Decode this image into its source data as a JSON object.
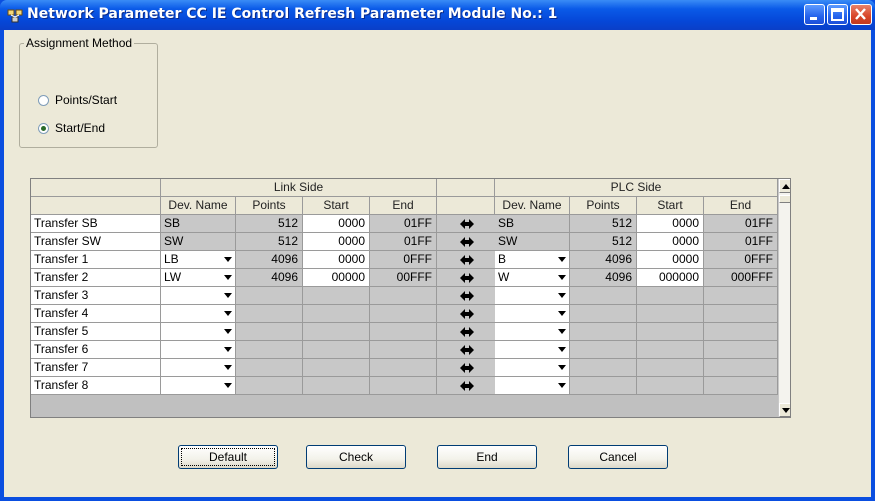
{
  "window": {
    "title": "Network Parameter  CC IE Control Refresh Parameter Module No.: 1"
  },
  "assignment": {
    "legend": "Assignment Method",
    "options": [
      {
        "label": "Points/Start",
        "selected": false
      },
      {
        "label": "Start/End",
        "selected": true
      }
    ]
  },
  "table": {
    "group_headers": {
      "link": "Link Side",
      "plc": "PLC Side"
    },
    "column_headers": {
      "dev_name": "Dev. Name",
      "points": "Points",
      "start": "Start",
      "end": "End"
    },
    "rows": [
      {
        "label": "Transfer SB",
        "link": {
          "dev": "SB",
          "points": "512",
          "start": "0000",
          "end": "01FF"
        },
        "plc": {
          "dev": "SB",
          "points": "512",
          "start": "0000",
          "end": "01FF"
        }
      },
      {
        "label": "Transfer SW",
        "link": {
          "dev": "SW",
          "points": "512",
          "start": "0000",
          "end": "01FF"
        },
        "plc": {
          "dev": "SW",
          "points": "512",
          "start": "0000",
          "end": "01FF"
        }
      },
      {
        "label": "Transfer 1",
        "link": {
          "dev": "LB",
          "points": "4096",
          "start": "0000",
          "end": "0FFF"
        },
        "plc": {
          "dev": "B",
          "points": "4096",
          "start": "0000",
          "end": "0FFF"
        }
      },
      {
        "label": "Transfer 2",
        "link": {
          "dev": "LW",
          "points": "4096",
          "start": "00000",
          "end": "00FFF"
        },
        "plc": {
          "dev": "W",
          "points": "4096",
          "start": "000000",
          "end": "000FFF"
        }
      },
      {
        "label": "Transfer 3",
        "link": {
          "dev": "",
          "points": "",
          "start": "",
          "end": ""
        },
        "plc": {
          "dev": "",
          "points": "",
          "start": "",
          "end": ""
        }
      },
      {
        "label": "Transfer 4",
        "link": {
          "dev": "",
          "points": "",
          "start": "",
          "end": ""
        },
        "plc": {
          "dev": "",
          "points": "",
          "start": "",
          "end": ""
        }
      },
      {
        "label": "Transfer 5",
        "link": {
          "dev": "",
          "points": "",
          "start": "",
          "end": ""
        },
        "plc": {
          "dev": "",
          "points": "",
          "start": "",
          "end": ""
        }
      },
      {
        "label": "Transfer 6",
        "link": {
          "dev": "",
          "points": "",
          "start": "",
          "end": ""
        },
        "plc": {
          "dev": "",
          "points": "",
          "start": "",
          "end": ""
        }
      },
      {
        "label": "Transfer 7",
        "link": {
          "dev": "",
          "points": "",
          "start": "",
          "end": ""
        },
        "plc": {
          "dev": "",
          "points": "",
          "start": "",
          "end": ""
        }
      },
      {
        "label": "Transfer 8",
        "link": {
          "dev": "",
          "points": "",
          "start": "",
          "end": ""
        },
        "plc": {
          "dev": "",
          "points": "",
          "start": "",
          "end": ""
        }
      }
    ]
  },
  "buttons": {
    "default": "Default",
    "check": "Check",
    "end": "End",
    "cancel": "Cancel"
  },
  "icons": {
    "window": "network-icon",
    "transfer": "double-arrow-icon",
    "minimize": "minimize-icon",
    "maximize": "maximize-icon",
    "close": "close-icon"
  },
  "colors": {
    "titlebar": "#0a5ae8",
    "client": "#ece9d8",
    "gray_cell": "#c8c8c8",
    "close_button": "#d8462a"
  }
}
